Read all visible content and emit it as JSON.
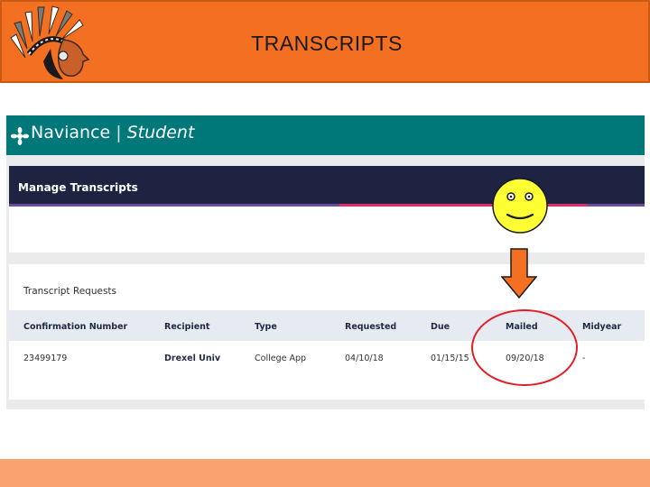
{
  "slide": {
    "title": "TRANSCRIPTS"
  },
  "naviance": {
    "brand": "Naviance",
    "separator": "|",
    "sub": "Student",
    "section_title": "Manage Transcripts",
    "requests_title": "Transcript Requests",
    "columns": [
      "Confirmation Number",
      "Recipient",
      "Type",
      "Requested",
      "Due",
      "Mailed",
      "Midyear"
    ],
    "rows": [
      {
        "confirmation": "23499179",
        "recipient": "Drexel Univ",
        "type": "College App",
        "requested": "04/10/18",
        "due": "01/15/15",
        "mailed": "09/20/18",
        "midyear": "-"
      }
    ]
  },
  "colors": {
    "banner": "#f36f21",
    "nav_teal": "#00787a",
    "header_navy": "#1d2340",
    "highlight_red": "#e31e24",
    "arrow_orange": "#f36f21",
    "smiley_yellow": "#ffff33"
  },
  "icons": [
    "indian-headdress-logo-icon",
    "naviance-logo-icon",
    "smiley-face-icon",
    "down-arrow-icon"
  ]
}
